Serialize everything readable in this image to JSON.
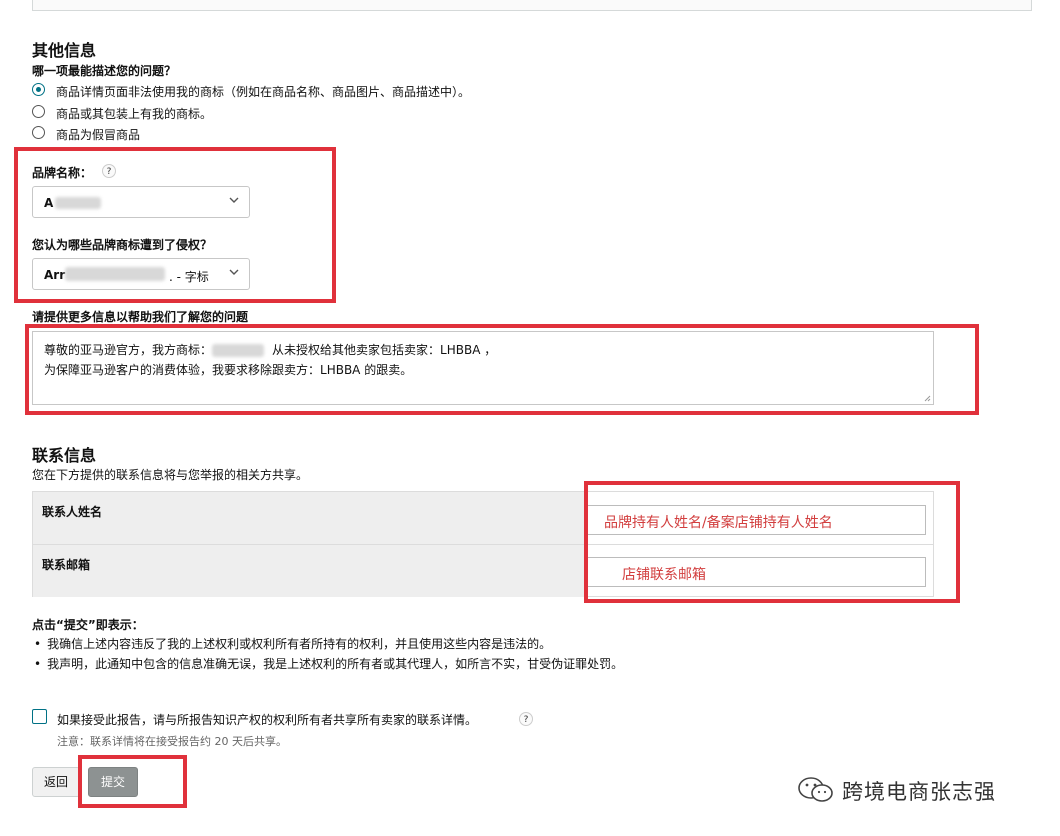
{
  "other": {
    "title": "其他信息",
    "question": "哪一项最能描述您的问题？",
    "options": [
      {
        "label": "商品详情页面非法使用我的商标（例如在商品名称、商品图片、商品描述中）。",
        "selected": true
      },
      {
        "label": "商品或其包装上有我的商标。",
        "selected": false
      },
      {
        "label": "商品为假冒商品",
        "selected": false
      }
    ],
    "brand_label": "品牌名称：",
    "brand_value": "A",
    "tm_label": "您认为哪些品牌商标遭到了侵权？",
    "tm_value_prefix": "Arr",
    "tm_value_suffix": ". - 字标",
    "help_glyph": "?",
    "info_label": "请提供更多信息以帮助我们了解您的问题",
    "info_line1_a": "尊敬的亚马逊官方，我方商标：",
    "info_line1_b": "从未授权给其他卖家包括卖家：LHBBA ，",
    "info_line2": "为保障亚马逊客户的消费体验，我要求移除跟卖方：LHBBA 的跟卖。"
  },
  "contact": {
    "title": "联系信息",
    "subtitle": "您在下方提供的联系信息将与您举报的相关方共享。",
    "name_label": "联系人姓名",
    "name_value": "品牌持有人姓名/备案店铺持有人姓名",
    "email_label": "联系邮箱",
    "email_value": "店铺联系邮箱"
  },
  "declaration": {
    "title": "点击“提交”即表示：",
    "items": [
      "我确信上述内容违反了我的上述权利或权利所有者所持有的权利，并且使用这些内容是违法的。",
      "我声明，此通知中包含的信息准确无误，我是上述权利的所有者或其代理人，如所言不实，甘受伪证罪处罚。"
    ]
  },
  "share": {
    "checkbox_label": "如果接受此报告，请与所报告知识产权的权利所有者共享所有卖家的联系详情。",
    "note": "注意：联系详情将在接受报告约 20 天后共享。"
  },
  "buttons": {
    "back": "返回",
    "submit": "提交"
  },
  "watermark": "跨境电商张志强",
  "colors": {
    "accent": "#007185",
    "highlight": "#e0313b",
    "annotation_text": "#d23e3e"
  }
}
